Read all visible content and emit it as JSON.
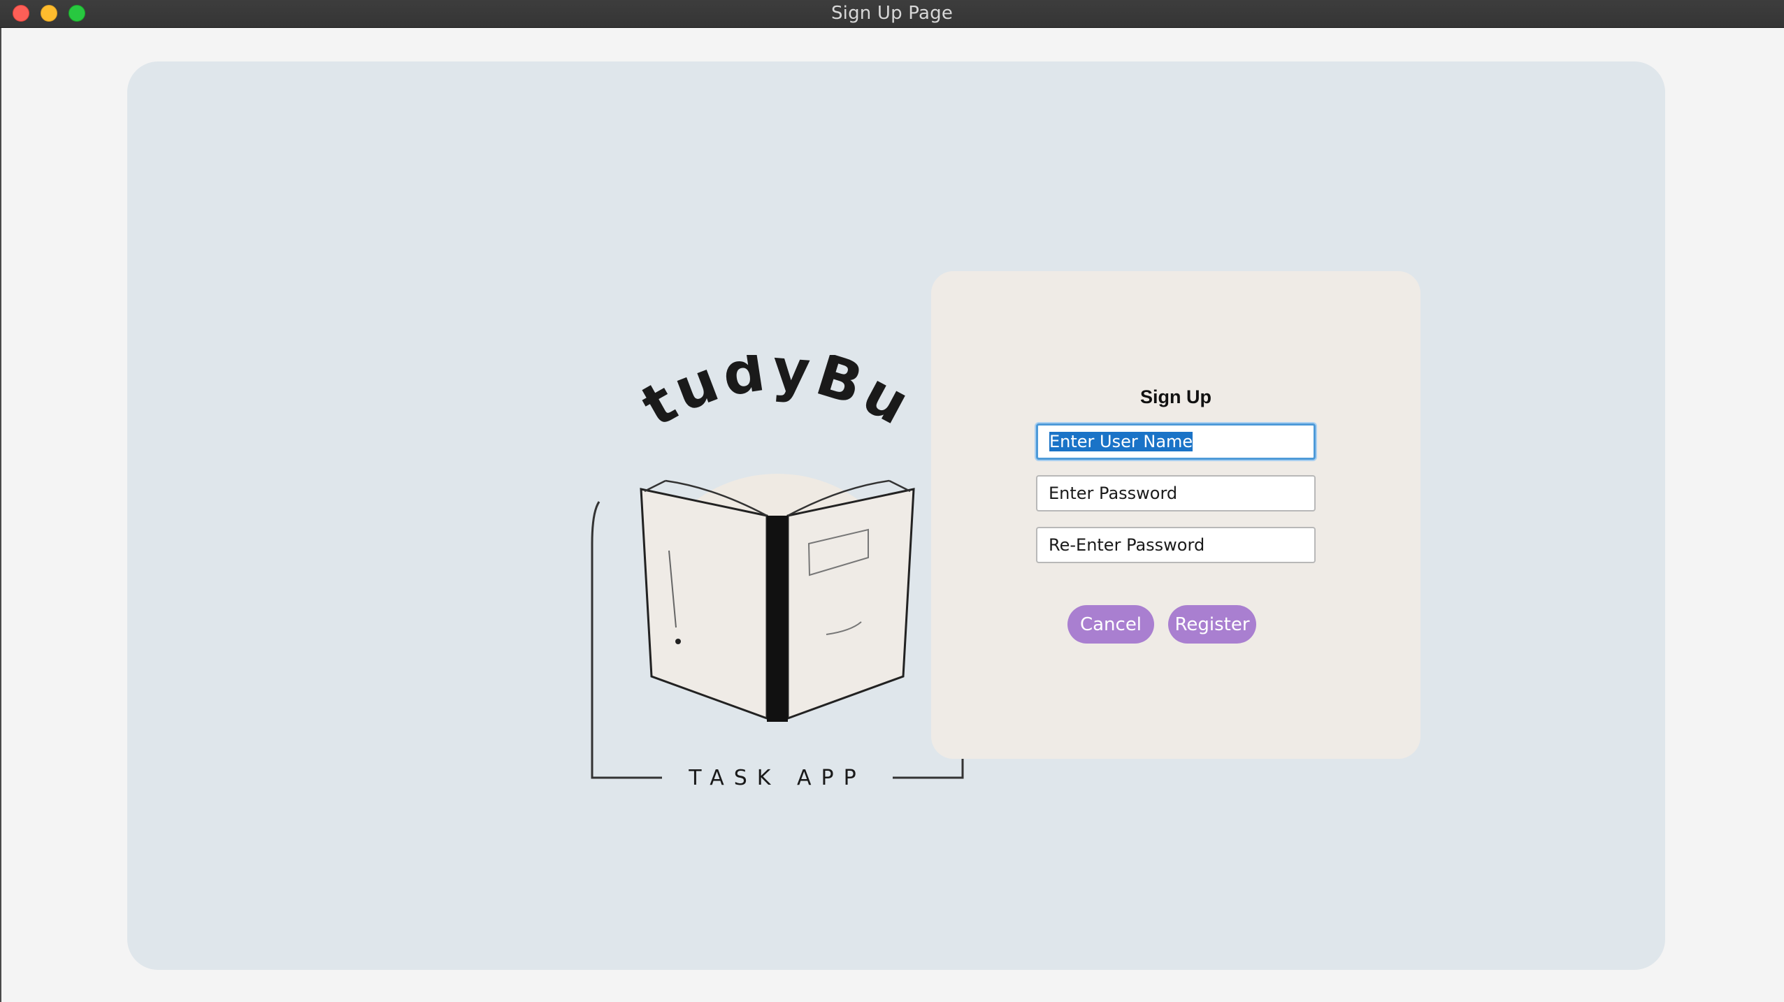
{
  "window": {
    "title": "Sign Up Page",
    "controls": [
      "close",
      "minimize",
      "maximize"
    ]
  },
  "logo": {
    "name": "StudyBud",
    "tagline": "TASK APP",
    "icon": "open-book-icon"
  },
  "form": {
    "title": "Sign Up",
    "username_field": "Enter User Name",
    "password_field": "Enter Password",
    "reenter_password_field": "Re-Enter Password",
    "cancel_label": "Cancel",
    "register_label": "Register"
  },
  "colors": {
    "panel": "#dfe6eb",
    "card": "#efebe6",
    "button": "#a97fd0",
    "focus": "#4e9ad8"
  }
}
